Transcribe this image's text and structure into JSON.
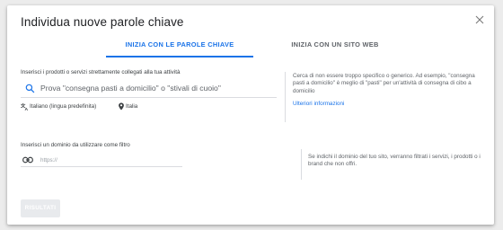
{
  "dialog": {
    "title": "Individua nuove parole chiave",
    "close_icon": "close-icon"
  },
  "tabs": [
    {
      "label": "INIZIA CON LE PAROLE CHIAVE",
      "active": true
    },
    {
      "label": "INIZIA CON UN SITO WEB",
      "active": false
    }
  ],
  "products_section": {
    "label": "Inserisci i prodotti o servizi strettamente collegati alla tua attività",
    "search_icon": "search-icon",
    "search_placeholder": "Prova \"consegna pasti a domicilio\" o \"stivali di cuoio\"",
    "language_icon": "translate-icon",
    "language": "Italiano (lingua predefinita)",
    "location_icon": "location-pin-icon",
    "location": "Italia"
  },
  "products_help": {
    "text": "Cerca di non essere troppo specifico o generico. Ad esempio, \"consegna pasti a domicilio\" è meglio di \"pasti\" per un'attività di consegna di cibo a domicilio",
    "link": "Ulteriori informazioni"
  },
  "domain_section": {
    "label": "Inserisci un dominio da utilizzare come filtro",
    "link_icon": "link-icon",
    "placeholder": "https://"
  },
  "domain_help": {
    "text": "Se indichi il dominio del tuo sito, verranno filtrati i servizi, i prodotti o i brand che non offri."
  },
  "actions": {
    "submit_label": "RISULTATI",
    "submit_enabled": false
  },
  "colors": {
    "accent": "#1a73e8",
    "disabled_button": "#e8eaed"
  }
}
